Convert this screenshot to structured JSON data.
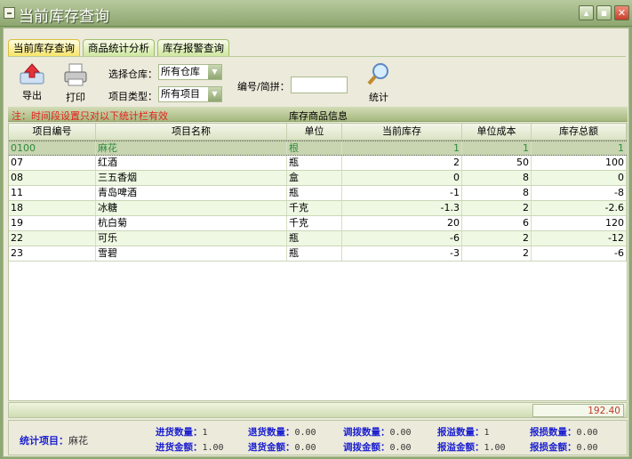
{
  "window": {
    "title": "当前库存查询"
  },
  "tabs": [
    "当前库存查询",
    "商品统计分析",
    "库存报警查询"
  ],
  "toolbar": {
    "export": "导出",
    "print": "打印",
    "stats": "统计",
    "warehouse_label": "选择仓库：",
    "warehouse_value": "所有仓库",
    "type_label": "项目类型：",
    "type_value": "所有项目",
    "code_label": "编号/简拼：",
    "code_value": ""
  },
  "note": "注：时间段设置只对以下统计栏有效",
  "grid_caption": "库存商品信息",
  "columns": [
    "项目编号",
    "项目名称",
    "单位",
    "当前库存",
    "单位成本",
    "库存总额"
  ],
  "rows": [
    [
      "0100",
      "麻花",
      "根",
      "1",
      "1",
      "1"
    ],
    [
      "07",
      "红酒",
      "瓶",
      "2",
      "50",
      "100"
    ],
    [
      "08",
      "三五香烟",
      "盒",
      "0",
      "8",
      "0"
    ],
    [
      "11",
      "青岛啤酒",
      "瓶",
      "-1",
      "8",
      "-8"
    ],
    [
      "18",
      "冰糖",
      "千克",
      "-1.3",
      "2",
      "-2.6"
    ],
    [
      "19",
      "杭白菊",
      "千克",
      "20",
      "6",
      "120"
    ],
    [
      "22",
      "可乐",
      "瓶",
      "-6",
      "2",
      "-12"
    ],
    [
      "23",
      "雪碧",
      "瓶",
      "-3",
      "2",
      "-6"
    ]
  ],
  "total": "192.40",
  "stats": {
    "item_label": "统计项目：",
    "item_value": "麻花",
    "fields": [
      {
        "label": "进货数量：",
        "value": "1"
      },
      {
        "label": "进货金额：",
        "value": "1.00"
      },
      {
        "label": "退货数量：",
        "value": "0.00"
      },
      {
        "label": "退货金额：",
        "value": "0.00"
      },
      {
        "label": "调拨数量：",
        "value": "0.00"
      },
      {
        "label": "调拨金额：",
        "value": "0.00"
      },
      {
        "label": "报溢数量：",
        "value": "1"
      },
      {
        "label": "报溢金额：",
        "value": "1.00"
      },
      {
        "label": "报损数量：",
        "value": "0.00"
      },
      {
        "label": "报损金额：",
        "value": "0.00"
      }
    ]
  }
}
